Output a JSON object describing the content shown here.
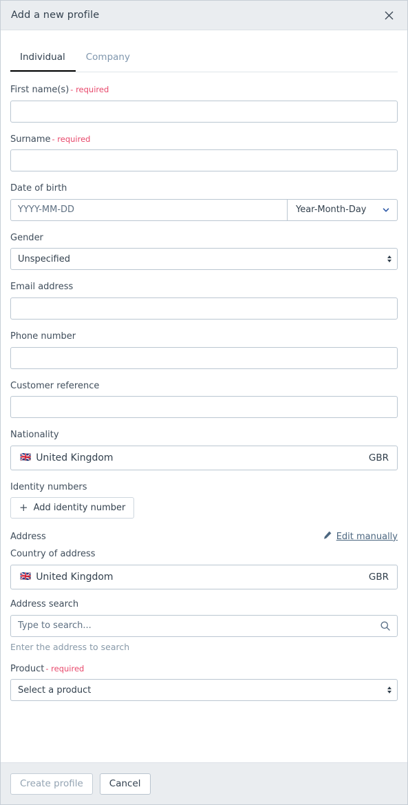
{
  "dialog": {
    "title": "Add a new profile",
    "close_icon": "close-icon"
  },
  "tabs": [
    {
      "label": "Individual",
      "active": true
    },
    {
      "label": "Company",
      "active": false
    }
  ],
  "form": {
    "required_suffix": "- required",
    "first_name": {
      "label": "First name(s)",
      "required": true,
      "value": "",
      "placeholder": ""
    },
    "surname": {
      "label": "Surname",
      "required": true,
      "value": "",
      "placeholder": ""
    },
    "date_of_birth": {
      "label": "Date of birth",
      "value": "",
      "placeholder": "YYYY-MM-DD",
      "format_selected": "Year-Month-Day"
    },
    "gender": {
      "label": "Gender",
      "selected": "Unspecified"
    },
    "email": {
      "label": "Email address",
      "value": "",
      "placeholder": ""
    },
    "phone": {
      "label": "Phone number",
      "value": "",
      "placeholder": ""
    },
    "customer_reference": {
      "label": "Customer reference",
      "value": "",
      "placeholder": ""
    },
    "nationality": {
      "label": "Nationality",
      "flag": "🇬🇧",
      "country": "United Kingdom",
      "code": "GBR"
    },
    "identity_numbers": {
      "label": "Identity numbers",
      "add_button": "Add identity number"
    },
    "address": {
      "section_label": "Address",
      "edit_link": "Edit manually",
      "country_label": "Country of address",
      "flag": "🇬🇧",
      "country": "United Kingdom",
      "code": "GBR",
      "search_label": "Address search",
      "search_value": "",
      "search_placeholder": "Type to search...",
      "help_text": "Enter the address to search"
    },
    "product": {
      "label": "Product",
      "required": true,
      "selected": "Select a product"
    }
  },
  "footer": {
    "create_label": "Create profile",
    "cancel_label": "Cancel"
  },
  "colors": {
    "header_bg": "#eaedf0",
    "required": "#e8486b",
    "active_tab_underline": "#000000",
    "link": "#4c6780",
    "border": "#bac6d1"
  }
}
